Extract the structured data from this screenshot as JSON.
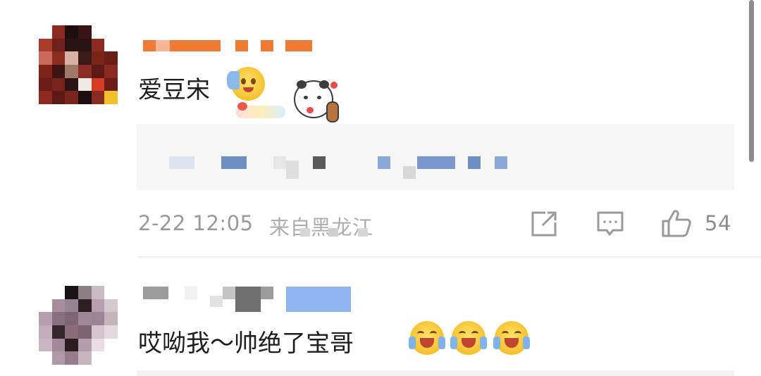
{
  "comments": [
    {
      "text": "爱豆宋",
      "meta": {
        "date": "2-22 12:05",
        "location": "来自黑龙江",
        "like_count": "54"
      },
      "icons": [
        "share-icon",
        "comment-icon",
        "like-icon"
      ],
      "sticker": "panda-sticker"
    },
    {
      "text": "哎呦我～帅绝了宝哥",
      "emojis": [
        "laughing-face-icon",
        "laughing-face-icon",
        "laughing-face-icon"
      ]
    }
  ],
  "colors": {
    "username_orange": "#f07a33",
    "meta_gray": "#9a9a9a",
    "reply_bg": "#f6f6f6",
    "blue_tag": "#8fb4ef"
  }
}
